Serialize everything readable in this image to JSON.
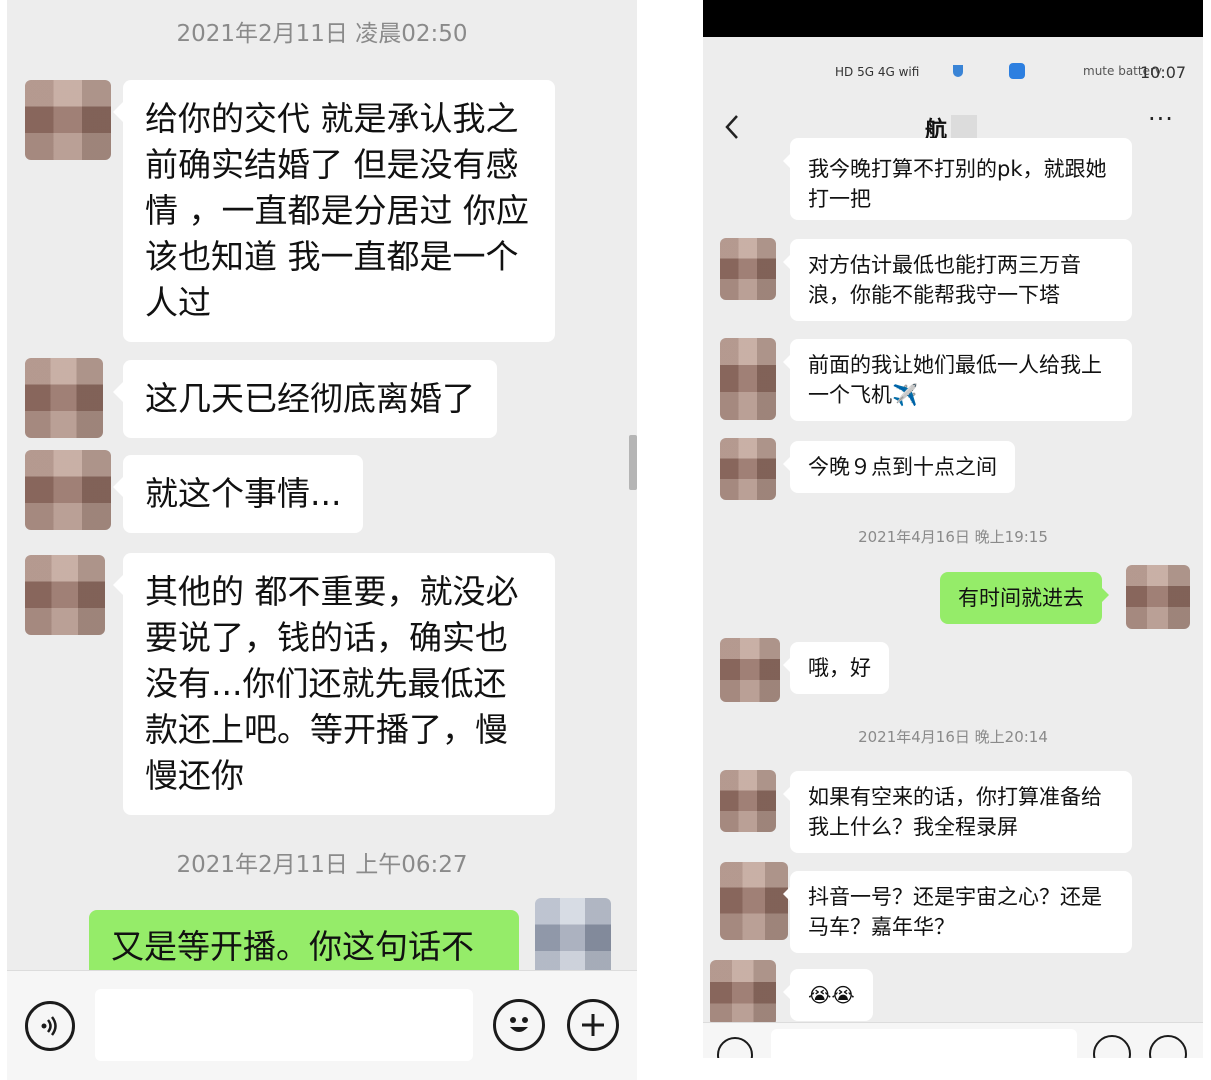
{
  "left_chat": {
    "timestamps": [
      "2021年2月11日 凌晨02:50",
      "2021年2月11日 上午06:27"
    ],
    "messages": [
      {
        "side": "received",
        "text": "给你的交代 就是承认我之前确实结婚了 但是没有感情 ，一直都是分居过 你应该也知道 我一直都是一个人过"
      },
      {
        "side": "received",
        "text": "这几天已经彻底离婚了"
      },
      {
        "side": "received",
        "text": "就这个事情..."
      },
      {
        "side": "received",
        "text": "其他的 都不重要，就没必要说了，钱的话，确实也没有...你们还就先最低还款还上吧。等开播了，慢慢还你"
      },
      {
        "side": "sent",
        "text": "又是等开播。你这句话不"
      }
    ],
    "input": {
      "voice_icon": "voice-icon",
      "emoji_icon": "emoji-icon",
      "plus_icon": "plus-icon"
    }
  },
  "right_chat": {
    "status": {
      "time": "10:07",
      "left_icons": "HD 5G 4G wifi",
      "right_icons": "mute battery"
    },
    "header": {
      "back_icon": "chevron-left-icon",
      "title": "航",
      "more_icon": "more-icon"
    },
    "timestamps": [
      "2021年4月16日 晚上19:15",
      "2021年4月16日 晚上20:14"
    ],
    "messages": [
      {
        "side": "received",
        "text": "我今晚打算不打别的pk，就跟她打一把"
      },
      {
        "side": "received",
        "text": "对方估计最低也能打两三万音浪，你能不能帮我守一下塔"
      },
      {
        "side": "received",
        "text": "前面的我让她们最低一人给我上一个飞机✈️"
      },
      {
        "side": "received",
        "text": "今晚９点到十点之间"
      },
      {
        "side": "sent",
        "text": "有时间就进去"
      },
      {
        "side": "received",
        "text": "哦，好"
      },
      {
        "side": "received",
        "text": "如果有空来的话，你打算准备给我上什么？我全程录屏"
      },
      {
        "side": "received",
        "text": "抖音一号？还是宇宙之心？还是马车？嘉年华？"
      },
      {
        "side": "received",
        "text": "😭😭"
      }
    ],
    "input": {
      "voice_icon": "voice-icon",
      "emoji_icon": "emoji-icon",
      "plus_icon": "plus-icon"
    }
  }
}
